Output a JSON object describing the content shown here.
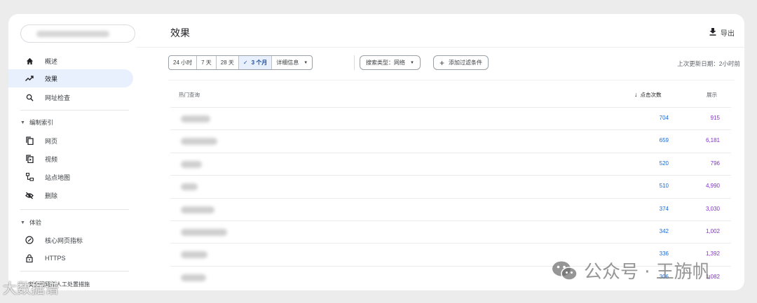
{
  "sidebar": {
    "overview_label": "概述",
    "performance_label": "效果",
    "url_inspection_label": "网址检查",
    "indexing_section": "编制索引",
    "pages_label": "网页",
    "videos_label": "视频",
    "sitemaps_label": "站点地图",
    "removals_label": "删除",
    "experience_section": "体验",
    "core_web_vitals_label": "核心网页指标",
    "https_label": "HTTPS",
    "security_label": "安全问题和人工处置措施"
  },
  "header": {
    "title": "效果",
    "export_label": "导出"
  },
  "filters": {
    "date_options": [
      "24 小时",
      "7 天",
      "28 天",
      "3 个月",
      "详细信息"
    ],
    "selected_check": "✓",
    "search_type_label": "搜索类型：网络",
    "add_filter_label": "添加过滤条件",
    "last_updated": "上次更新日期：2小时前"
  },
  "table": {
    "col_query": "热门查询",
    "col_clicks": "点击次数",
    "col_impressions": "展示",
    "rows": [
      {
        "clicks": "704",
        "impressions": "915"
      },
      {
        "clicks": "659",
        "impressions": "6,181"
      },
      {
        "clicks": "520",
        "impressions": "796"
      },
      {
        "clicks": "510",
        "impressions": "4,990"
      },
      {
        "clicks": "374",
        "impressions": "3,030"
      },
      {
        "clicks": "342",
        "impressions": "1,002"
      },
      {
        "clicks": "336",
        "impressions": "1,392"
      },
      {
        "clicks": "306",
        "impressions": "1,082"
      }
    ]
  },
  "watermarks": {
    "right": "公众号 · 王旃帆",
    "left": "大数据谱"
  },
  "colors": {
    "accent": "#1967d2",
    "impressions": "#8430ce",
    "active_bg": "#e8f0fe"
  },
  "icons": [
    "home-icon",
    "trending-up-icon",
    "search-icon",
    "pages-icon",
    "video-icon",
    "sitemap-icon",
    "eye-off-icon",
    "gauge-icon",
    "lock-icon",
    "download-icon",
    "arrow-down-icon"
  ]
}
